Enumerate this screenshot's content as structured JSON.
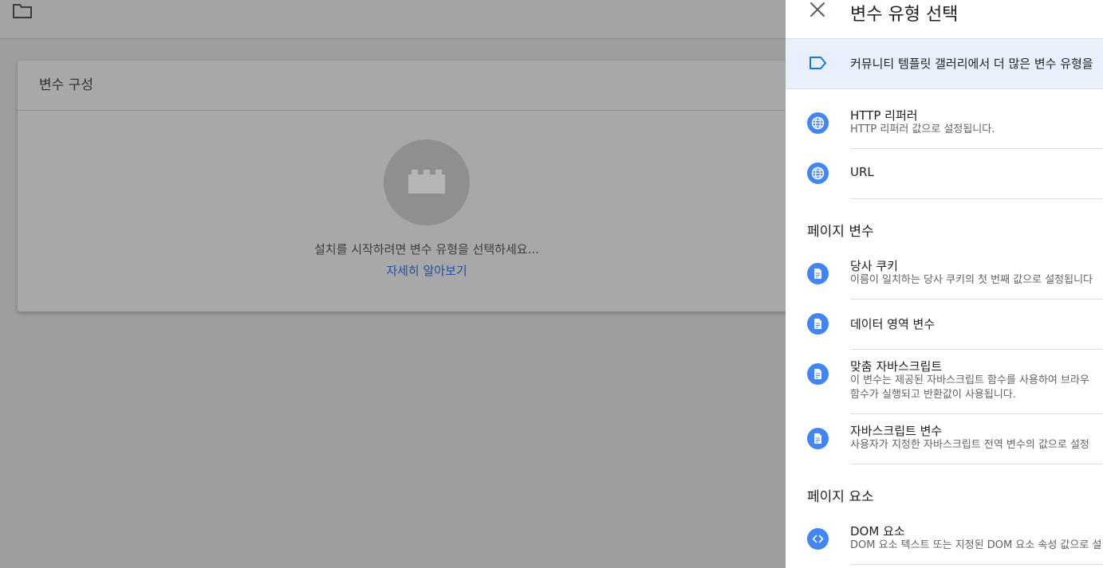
{
  "background": {
    "card_title": "변수 구성",
    "card_message": "설치를 시작하려면 변수 유형을 선택하세요...",
    "card_link": "자세히 알아보기"
  },
  "panel": {
    "title": "변수 유형 선택",
    "gallery_link": "커뮤니티 템플릿 갤러리에서 더 많은 변수 유형을",
    "items_top": [
      {
        "title": "HTTP 리퍼러",
        "desc": "HTTP 리퍼러 값으로 설정됩니다.",
        "icon": "globe-icon"
      },
      {
        "title": "URL",
        "desc": "",
        "icon": "globe-icon"
      }
    ],
    "section_page_vars": "페이지 변수",
    "items_page_vars": [
      {
        "title": "당사 쿠키",
        "desc": "이름이 일치하는 당사 쿠키의 첫 번째 값으로 설정됩니다",
        "icon": "document-icon"
      },
      {
        "title": "데이터 영역 변수",
        "desc": "",
        "icon": "document-icon"
      },
      {
        "title": "맞춤 자바스크립트",
        "desc": "이 변수는 제공된 자바스크립트 함수를 사용하여 브라우",
        "desc2": "함수가 실행되고 반환값이 사용됩니다.",
        "icon": "document-icon"
      },
      {
        "title": "자바스크립트 변수",
        "desc": "사용자가 지정한 자바스크립트 전역 변수의 값으로 설정",
        "icon": "document-icon"
      }
    ],
    "section_page_elements": "페이지 요소",
    "items_page_elements": [
      {
        "title": "DOM 요소",
        "desc": "DOM 요소 텍스트 또는 지정된 DOM 요소 속성 값으로 설",
        "icon": "code-icon"
      }
    ]
  },
  "colors": {
    "accent": "#4285f4",
    "gallery_bg": "#e8f0fe",
    "link": "#1a4fa8"
  }
}
